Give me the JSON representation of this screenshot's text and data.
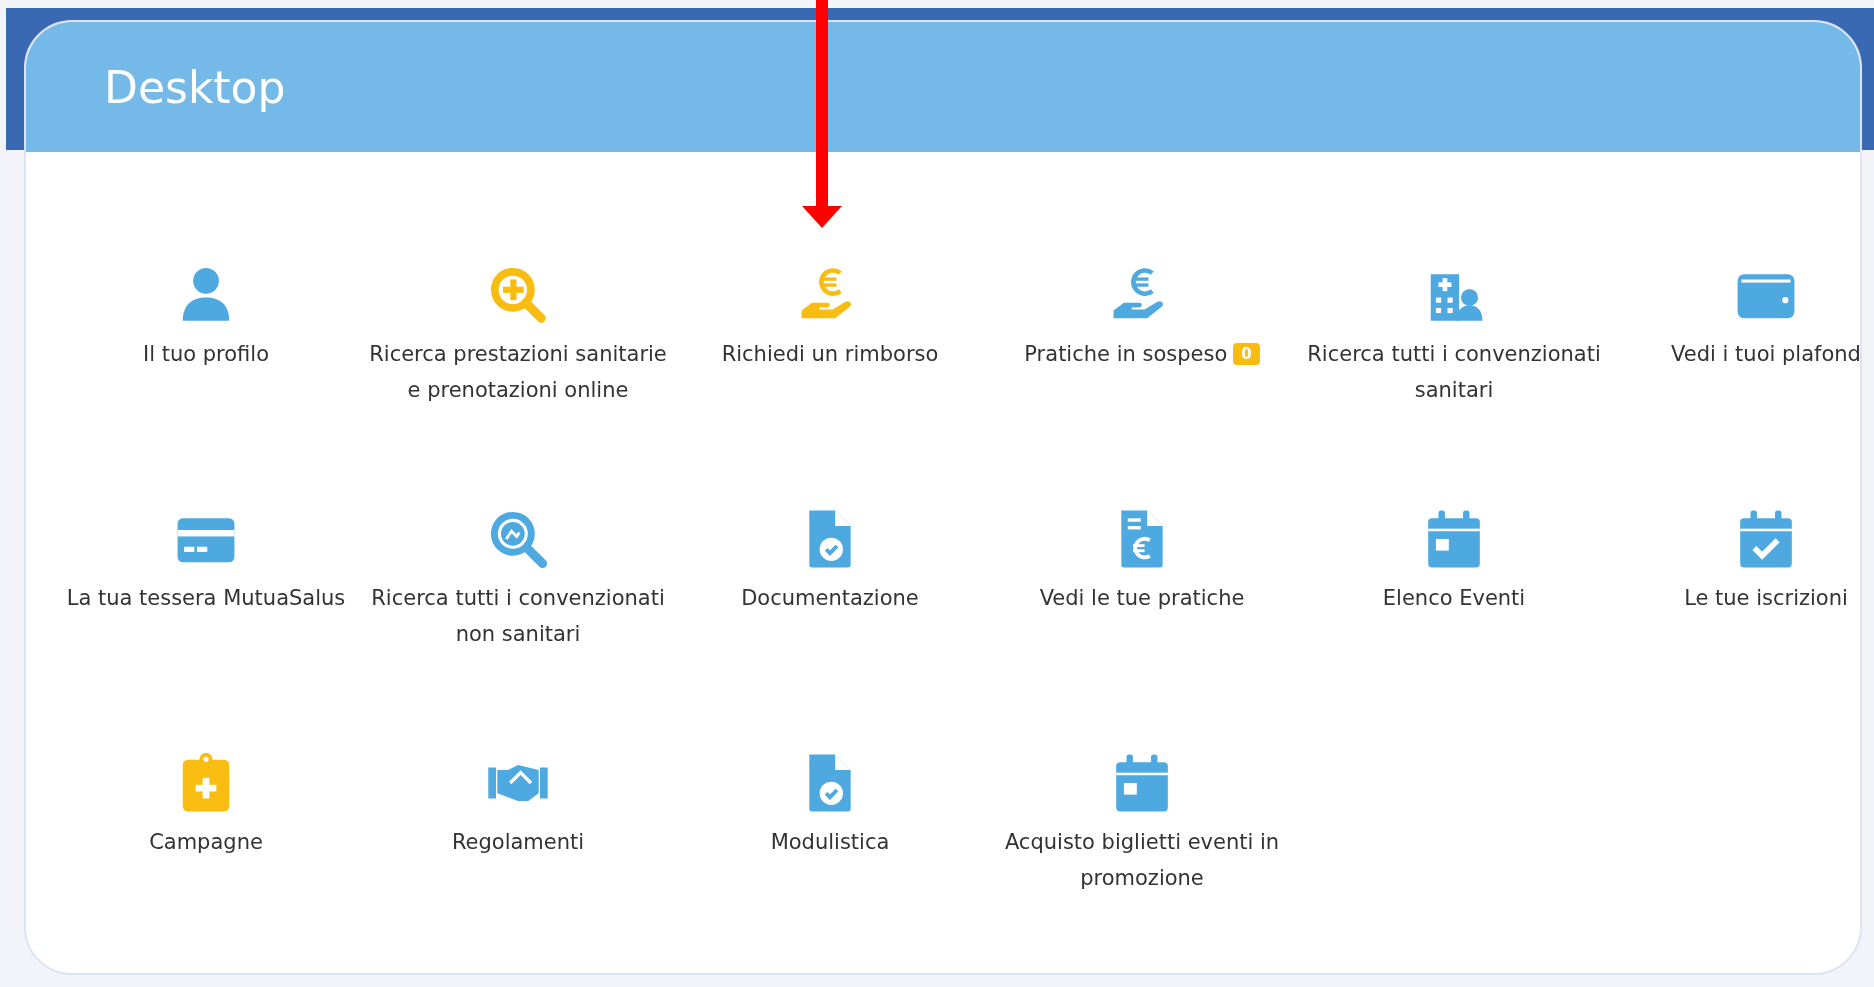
{
  "header": {
    "title": "Desktop"
  },
  "tiles": [
    {
      "label": "Il tuo profilo",
      "kind": "user",
      "color": "#4ea9e1"
    },
    {
      "label": "Ricerca prestazioni sanitarie e prenotazioni online",
      "kind": "search-plus",
      "color": "#f9bd12"
    },
    {
      "label": "Richiedi un rimborso",
      "kind": "hand-euro",
      "color": "#f9bd12"
    },
    {
      "label": "Pratiche in sospeso",
      "kind": "hand-euro",
      "color": "#4ea9e1",
      "badge": "0"
    },
    {
      "label": "Ricerca tutti i convenzionati sanitari",
      "kind": "hospital",
      "color": "#4ea9e1"
    },
    {
      "label": "Vedi i tuoi plafond",
      "kind": "wallet",
      "color": "#4ea9e1"
    },
    {
      "label": "La tua tessera MutuaSalus",
      "kind": "card",
      "color": "#4ea9e1"
    },
    {
      "label": "Ricerca tutti i convenzionati non sanitari",
      "kind": "search-image",
      "color": "#4ea9e1"
    },
    {
      "label": "Documentazione",
      "kind": "doc-check",
      "color": "#4ea9e1"
    },
    {
      "label": "Vedi le tue pratiche",
      "kind": "doc-euro",
      "color": "#4ea9e1"
    },
    {
      "label": "Elenco Eventi",
      "kind": "calendar",
      "color": "#4ea9e1"
    },
    {
      "label": "Le tue iscrizioni",
      "kind": "calendar-check",
      "color": "#4ea9e1"
    },
    {
      "label": "Campagne",
      "kind": "clipboard-plus",
      "color": "#f9bd12"
    },
    {
      "label": "Regolamenti",
      "kind": "handshake",
      "color": "#4ea9e1"
    },
    {
      "label": "Modulistica",
      "kind": "doc-check",
      "color": "#4ea9e1"
    },
    {
      "label": "Acquisto biglietti eventi in promozione",
      "kind": "calendar",
      "color": "#4ea9e1"
    }
  ]
}
